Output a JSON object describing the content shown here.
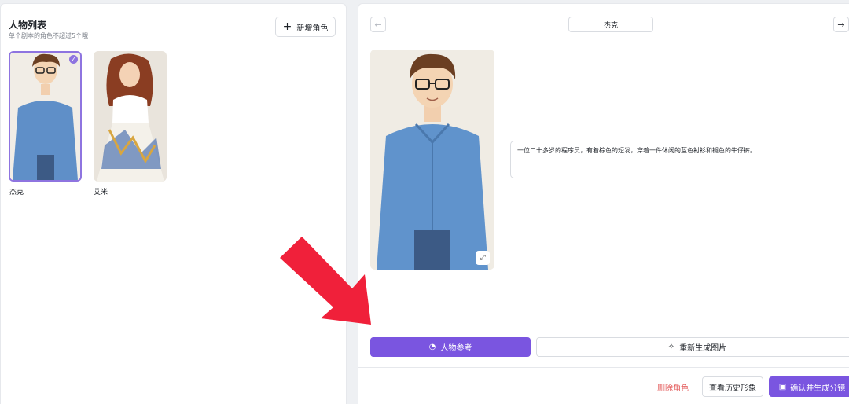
{
  "left_panel": {
    "title": "人物列表",
    "subtitle": "单个剧本的角色不超过5个哦",
    "add_button": "新增角色",
    "characters": [
      {
        "name": "杰克",
        "selected": true
      },
      {
        "name": "艾米",
        "selected": false
      }
    ]
  },
  "right_panel": {
    "current_name": "杰克",
    "description": "一位二十多岁的程序员，有着棕色的短发，穿着一件休闲的蓝色衬衫和褪色的牛仔裤。",
    "reference_button": "人物参考",
    "regenerate_button": "重新生成图片",
    "delete_link": "删除角色",
    "history_button": "查看历史形象",
    "confirm_button": "确认并生成分镜"
  },
  "colors": {
    "accent": "#7a55e0",
    "danger": "#e25252",
    "annotation_arrow": "#f0203a"
  },
  "icons": [
    "plus-icon",
    "check-icon",
    "arrow-left-icon",
    "arrow-right-icon",
    "expand-icon",
    "reference-icon",
    "magic-wand-icon",
    "clapperboard-icon"
  ]
}
